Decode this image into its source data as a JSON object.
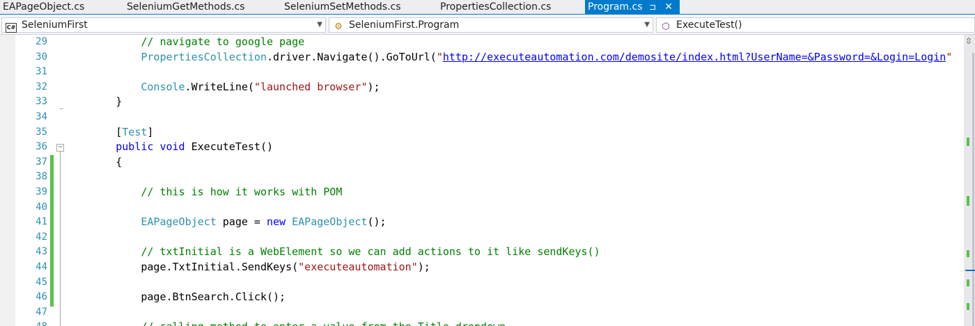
{
  "tabs": [
    {
      "label": "EAPageObject.cs",
      "active": false
    },
    {
      "label": "SeleniumGetMethods.cs",
      "active": false
    },
    {
      "label": "SeleniumSetMethods.cs",
      "active": false
    },
    {
      "label": "PropertiesCollection.cs",
      "active": false
    },
    {
      "label": "Program.cs",
      "active": true
    }
  ],
  "navbar": {
    "project": {
      "icon": "csharp-project-icon",
      "label": "SeleniumFirst"
    },
    "type": {
      "icon": "class-icon",
      "label": "SeleniumFirst.Program"
    },
    "member": {
      "icon": "method-icon",
      "label": "ExecuteTest()"
    }
  },
  "editor": {
    "lines": [
      {
        "num": "29",
        "tokens": [
          [
            "",
            "            "
          ],
          [
            "cm",
            "// navigate to google page"
          ]
        ]
      },
      {
        "num": "30",
        "tokens": [
          [
            "",
            "            "
          ],
          [
            "ty",
            "PropertiesCollection"
          ],
          [
            "",
            ".driver.Navigate().GoToUrl("
          ],
          [
            "st",
            "\""
          ],
          [
            "url",
            "http://executeautomation.com/demosite/index.html?UserName=&Password=&Login=Login"
          ],
          [
            "st",
            "\""
          ]
        ]
      },
      {
        "num": "31",
        "tokens": []
      },
      {
        "num": "32",
        "tokens": [
          [
            "",
            "            "
          ],
          [
            "ty",
            "Console"
          ],
          [
            "",
            ".WriteLine("
          ],
          [
            "st",
            "\"launched browser\""
          ],
          [
            "",
            ");"
          ]
        ]
      },
      {
        "num": "33",
        "tokens": [
          [
            "",
            "        }"
          ]
        ]
      },
      {
        "num": "34",
        "tokens": []
      },
      {
        "num": "35",
        "tokens": [
          [
            "",
            "        ["
          ],
          [
            "ty",
            "Test"
          ],
          [
            "",
            "]"
          ]
        ]
      },
      {
        "num": "36",
        "tokens": [
          [
            "",
            "        "
          ],
          [
            "kw",
            "public"
          ],
          [
            "",
            " "
          ],
          [
            "kw",
            "void"
          ],
          [
            "",
            " ExecuteTest()"
          ]
        ]
      },
      {
        "num": "37",
        "tokens": [
          [
            "",
            "        {"
          ]
        ]
      },
      {
        "num": "38",
        "tokens": []
      },
      {
        "num": "39",
        "tokens": [
          [
            "",
            "            "
          ],
          [
            "cm",
            "// this is how it works with POM"
          ]
        ]
      },
      {
        "num": "40",
        "tokens": []
      },
      {
        "num": "41",
        "tokens": [
          [
            "",
            "            "
          ],
          [
            "ty",
            "EAPageObject"
          ],
          [
            "",
            " page = "
          ],
          [
            "kw",
            "new"
          ],
          [
            "",
            " "
          ],
          [
            "ty",
            "EAPageObject"
          ],
          [
            "",
            "();"
          ]
        ]
      },
      {
        "num": "42",
        "tokens": []
      },
      {
        "num": "43",
        "tokens": [
          [
            "",
            "            "
          ],
          [
            "cm",
            "// txtInitial is a WebElement so we can add actions to it like sendKeys()"
          ]
        ]
      },
      {
        "num": "44",
        "tokens": [
          [
            "",
            "            page.TxtInitial.SendKeys("
          ],
          [
            "st",
            "\"executeautomation\""
          ],
          [
            "",
            ");"
          ]
        ]
      },
      {
        "num": "45",
        "tokens": []
      },
      {
        "num": "46",
        "tokens": [
          [
            "",
            "            page.BtnSearch.Click();"
          ]
        ]
      },
      {
        "num": "47",
        "tokens": []
      },
      {
        "num": "48",
        "tokens": [
          [
            "",
            "            "
          ],
          [
            "cm",
            "// calling method to enter a value from the Title dropdown"
          ]
        ]
      }
    ]
  },
  "icons": {
    "pin": "pin-icon",
    "close": "close-icon",
    "fold": "collapse-icon",
    "split": "split-editor-icon"
  }
}
